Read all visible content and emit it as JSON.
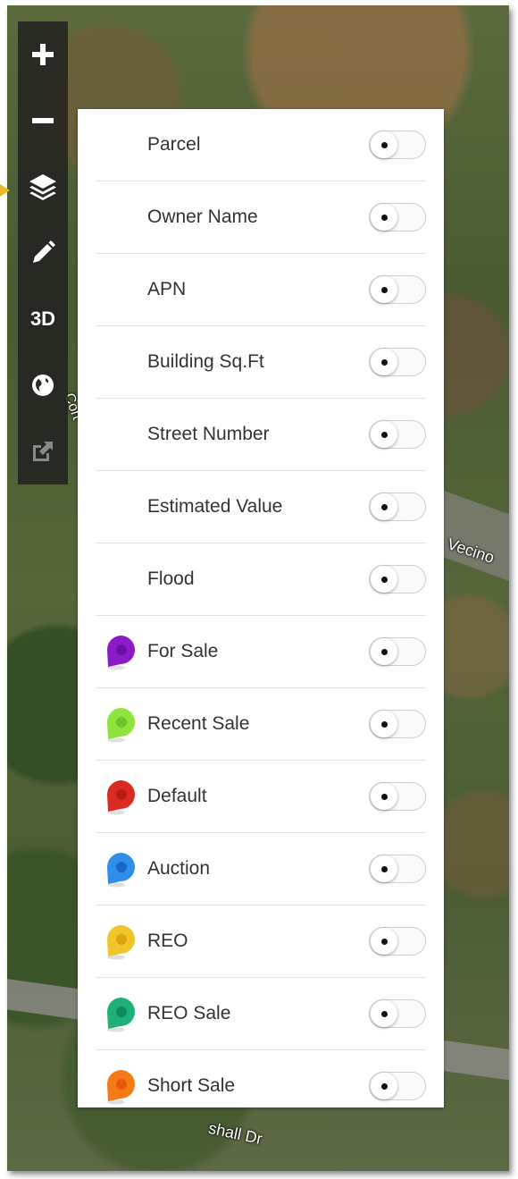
{
  "map": {
    "street_labels": [
      "Vecino",
      "shall Dr",
      "Cort"
    ]
  },
  "toolbar": {
    "tools": [
      {
        "name": "zoom-in",
        "glyph": "+"
      },
      {
        "name": "zoom-out",
        "glyph": "−"
      },
      {
        "name": "layers",
        "glyph": "layers"
      },
      {
        "name": "draw",
        "glyph": "pencil"
      },
      {
        "name": "3d",
        "glyph": "3D"
      },
      {
        "name": "globe",
        "glyph": "globe"
      },
      {
        "name": "share",
        "glyph": "external-link"
      }
    ]
  },
  "layers": {
    "items": [
      {
        "label": "Parcel",
        "enabled": false
      },
      {
        "label": "Owner Name",
        "enabled": false
      },
      {
        "label": "APN",
        "enabled": false
      },
      {
        "label": "Building Sq.Ft",
        "enabled": false
      },
      {
        "label": "Street Number",
        "enabled": false
      },
      {
        "label": "Estimated Value",
        "enabled": false
      },
      {
        "label": "Flood",
        "enabled": false
      },
      {
        "label": "For Sale",
        "enabled": false,
        "pin_color": "#8a1bc7",
        "dot_color": "#6a10a8"
      },
      {
        "label": "Recent Sale",
        "enabled": false,
        "pin_color": "#8fe33a",
        "dot_color": "#6cc42a"
      },
      {
        "label": "Default",
        "enabled": false,
        "pin_color": "#d92b20",
        "dot_color": "#b81c14"
      },
      {
        "label": "Auction",
        "enabled": false,
        "pin_color": "#2f8fe8",
        "dot_color": "#1768c9"
      },
      {
        "label": "REO",
        "enabled": false,
        "pin_color": "#f0c52a",
        "dot_color": "#d8a410"
      },
      {
        "label": "REO Sale",
        "enabled": false,
        "pin_color": "#1fb07a",
        "dot_color": "#0f8a5c"
      },
      {
        "label": "Short Sale",
        "enabled": false,
        "pin_color": "#f47a16",
        "dot_color": "#e8580a"
      }
    ]
  }
}
